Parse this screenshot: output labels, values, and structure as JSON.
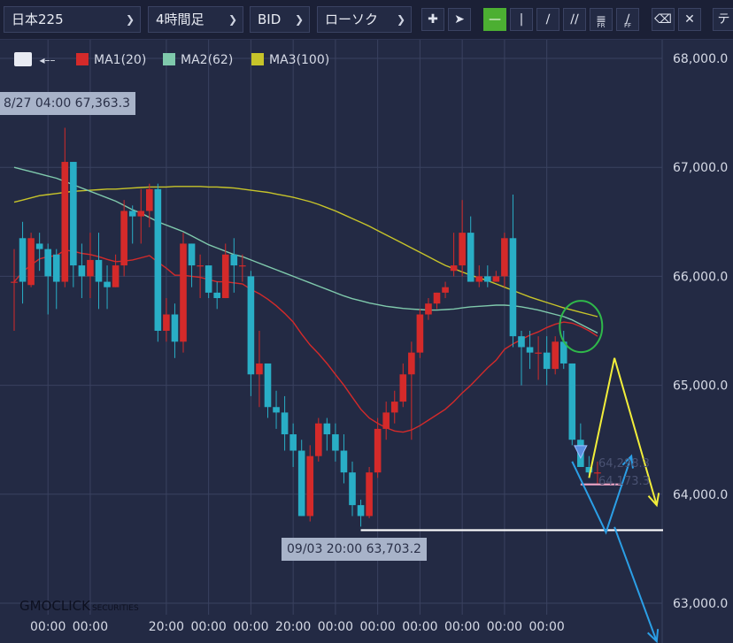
{
  "toolbar": {
    "instrument": "日本225",
    "timeframe": "4時間足",
    "price_side": "BID",
    "chart_style": "ローソク",
    "tool_fr_label": "FR",
    "tool_ff_label": "FF",
    "overflow_label": "テ"
  },
  "legend": {
    "ma1": {
      "label": "MA1(20)",
      "color": "#d42a2a"
    },
    "ma2": {
      "label": "MA2(62)",
      "color": "#7fc9ac"
    },
    "ma3": {
      "label": "MA3(100)",
      "color": "#c7c42a"
    }
  },
  "callouts": {
    "high": "8/27 04:00 67,363.3",
    "low": "09/03 20:00 63,703.2"
  },
  "faded_price_labels": [
    "64,298.3",
    "64,173.3"
  ],
  "brand": {
    "name": "GMOCLICK",
    "suffix": "SECURITIES"
  },
  "chart_data": {
    "type": "candlestick",
    "title": "",
    "xlabel": "",
    "ylabel": "",
    "ylim": [
      62900,
      68150
    ],
    "y_ticks": [
      68000,
      67000,
      66000,
      65000,
      64000,
      63000
    ],
    "y_tick_labels": [
      "68,000.0",
      "67,000.0",
      "66,000.0",
      "65,000.0",
      "64,000.0",
      "63,000.0"
    ],
    "x_tick_labels": [
      "00:00",
      "00:00",
      "20:00",
      "00:00",
      "00:00",
      "20:00",
      "00:00",
      "00:00",
      "00:00",
      "00:00",
      "00:00",
      "00:00"
    ],
    "x_tick_indices": [
      4,
      9,
      18,
      23,
      28,
      33,
      38,
      43,
      48,
      53,
      58,
      63
    ],
    "candle_colors": {
      "up": "#d42a2a",
      "down": "#29aec6"
    },
    "candles": [
      [
        65950,
        66250,
        65500,
        65950
      ],
      [
        66350,
        66500,
        65750,
        65950
      ],
      [
        65920,
        66400,
        65900,
        66350
      ],
      [
        66300,
        66400,
        66050,
        66250
      ],
      [
        66250,
        66300,
        65650,
        66000
      ],
      [
        66200,
        66250,
        65700,
        65950
      ],
      [
        65950,
        67363,
        65900,
        67050
      ],
      [
        67050,
        67050,
        65900,
        66100
      ],
      [
        66100,
        66300,
        65800,
        66000
      ],
      [
        66000,
        66400,
        65800,
        66150
      ],
      [
        66150,
        66400,
        65700,
        65950
      ],
      [
        65950,
        66100,
        65700,
        65900
      ],
      [
        65900,
        66200,
        65900,
        66100
      ],
      [
        66100,
        66700,
        66000,
        66600
      ],
      [
        66600,
        66650,
        66300,
        66550
      ],
      [
        66550,
        66800,
        66300,
        66600
      ],
      [
        66600,
        66850,
        66450,
        66800
      ],
      [
        66800,
        66850,
        65400,
        65500
      ],
      [
        65500,
        65800,
        65400,
        65650
      ],
      [
        65650,
        65750,
        65250,
        65400
      ],
      [
        65400,
        66400,
        65300,
        66300
      ],
      [
        66300,
        66300,
        65900,
        66100
      ],
      [
        66100,
        66200,
        65800,
        66100
      ],
      [
        66100,
        66100,
        65800,
        65850
      ],
      [
        65850,
        65950,
        65700,
        65800
      ],
      [
        65800,
        66300,
        65800,
        66200
      ],
      [
        66200,
        66350,
        65850,
        66100
      ],
      [
        66100,
        66200,
        65950,
        66100
      ],
      [
        66000,
        66050,
        64900,
        65100
      ],
      [
        65100,
        65500,
        64800,
        65200
      ],
      [
        65200,
        65200,
        64700,
        64800
      ],
      [
        64800,
        64950,
        64600,
        64750
      ],
      [
        64750,
        64900,
        64400,
        64550
      ],
      [
        64550,
        64650,
        64250,
        64400
      ],
      [
        64400,
        64500,
        63800,
        63800
      ],
      [
        63800,
        64450,
        63750,
        64350
      ],
      [
        64350,
        64700,
        64300,
        64650
      ],
      [
        64650,
        64700,
        64400,
        64550
      ],
      [
        64550,
        64650,
        64300,
        64400
      ],
      [
        64400,
        64550,
        64100,
        64200
      ],
      [
        64200,
        64300,
        63800,
        63900
      ],
      [
        63900,
        63950,
        63703,
        63800
      ],
      [
        63800,
        64250,
        63780,
        64200
      ],
      [
        64200,
        64700,
        64150,
        64600
      ],
      [
        64600,
        64850,
        64500,
        64750
      ],
      [
        64750,
        64950,
        64650,
        64850
      ],
      [
        64850,
        65200,
        64800,
        65100
      ],
      [
        65100,
        65400,
        64500,
        65300
      ],
      [
        65300,
        65700,
        65250,
        65650
      ],
      [
        65650,
        65800,
        65600,
        65750
      ],
      [
        65750,
        65850,
        65700,
        65850
      ],
      [
        65850,
        65950,
        65800,
        65900
      ],
      [
        66050,
        66400,
        66000,
        66100
      ],
      [
        66100,
        66700,
        66000,
        66400
      ],
      [
        66400,
        66550,
        65950,
        65950
      ],
      [
        65950,
        66100,
        65900,
        66000
      ],
      [
        66000,
        66100,
        65900,
        65950
      ],
      [
        65950,
        66050,
        65950,
        66000
      ],
      [
        66000,
        66400,
        65900,
        66350
      ],
      [
        66350,
        66750,
        65350,
        65450
      ],
      [
        65450,
        65500,
        65000,
        65350
      ],
      [
        65350,
        65500,
        65150,
        65300
      ],
      [
        65300,
        65450,
        65050,
        65300
      ],
      [
        65300,
        65450,
        65000,
        65150
      ],
      [
        65150,
        65450,
        65100,
        65400
      ],
      [
        65400,
        65500,
        65150,
        65200
      ],
      [
        65200,
        65200,
        64450,
        64500
      ],
      [
        64500,
        64650,
        64250,
        64250
      ],
      [
        64250,
        64350,
        64150,
        64200
      ],
      [
        64200,
        64300,
        64100,
        64200
      ]
    ],
    "ma1": [
      65950,
      66040,
      66105,
      66160,
      66180,
      66190,
      66240,
      66230,
      66210,
      66200,
      66180,
      66155,
      66135,
      66140,
      66150,
      66170,
      66190,
      66130,
      66075,
      66010,
      66010,
      66000,
      65990,
      65970,
      65950,
      65950,
      65940,
      65930,
      65880,
      65840,
      65790,
      65730,
      65660,
      65580,
      65470,
      65370,
      65290,
      65200,
      65100,
      65000,
      64890,
      64780,
      64700,
      64650,
      64610,
      64580,
      64570,
      64590,
      64630,
      64680,
      64730,
      64780,
      64850,
      64930,
      65000,
      65080,
      65160,
      65230,
      65330,
      65380,
      65420,
      65460,
      65490,
      65530,
      65560,
      65580,
      65570,
      65540,
      65500,
      65450
    ],
    "ma2": [
      67000,
      66980,
      66960,
      66940,
      66920,
      66900,
      66870,
      66840,
      66810,
      66780,
      66750,
      66720,
      66690,
      66650,
      66610,
      66580,
      66540,
      66500,
      66470,
      66440,
      66410,
      66370,
      66330,
      66290,
      66260,
      66230,
      66200,
      66180,
      66150,
      66120,
      66090,
      66060,
      66030,
      66000,
      65970,
      65940,
      65910,
      65880,
      65850,
      65820,
      65795,
      65775,
      65755,
      65740,
      65725,
      65715,
      65705,
      65700,
      65695,
      65690,
      65690,
      65695,
      65700,
      65710,
      65720,
      65725,
      65730,
      65735,
      65735,
      65730,
      65720,
      65705,
      65690,
      65670,
      65650,
      65630,
      65600,
      65560,
      65520,
      65480
    ],
    "ma3": [
      66680,
      66700,
      66720,
      66740,
      66750,
      66760,
      66770,
      66780,
      66785,
      66790,
      66795,
      66800,
      66800,
      66805,
      66810,
      66815,
      66820,
      66820,
      66820,
      66825,
      66825,
      66825,
      66825,
      66820,
      66820,
      66815,
      66810,
      66800,
      66790,
      66780,
      66770,
      66755,
      66740,
      66725,
      66705,
      66685,
      66660,
      66630,
      66600,
      66565,
      66530,
      66495,
      66460,
      66420,
      66380,
      66340,
      66300,
      66260,
      66220,
      66180,
      66140,
      66100,
      66070,
      66040,
      66010,
      65985,
      65960,
      65930,
      65900,
      65870,
      65840,
      65810,
      65785,
      65760,
      65735,
      65710,
      65690,
      65670,
      65650,
      65630
    ],
    "horizontal_lines": [
      {
        "value": 63670,
        "color": "#ffffff",
        "from_index": 41,
        "to_index": 77
      },
      {
        "value": 64090,
        "color": "#f1a8c8",
        "from_index": 67,
        "to_index": 72
      }
    ],
    "circle_annotation": {
      "index": 66,
      "value": 65540,
      "color": "#2fb84a"
    },
    "yellow_path": [
      [
        68,
        64150
      ],
      [
        71,
        65250
      ],
      [
        76,
        63900
      ]
    ],
    "blue_path_1": [
      [
        66,
        64300
      ],
      [
        70,
        63650
      ],
      [
        73,
        64350
      ]
    ],
    "blue_path_2": [
      [
        71,
        63700
      ],
      [
        76,
        62650
      ]
    ],
    "marker_index": 67,
    "marker_value": 64300
  }
}
